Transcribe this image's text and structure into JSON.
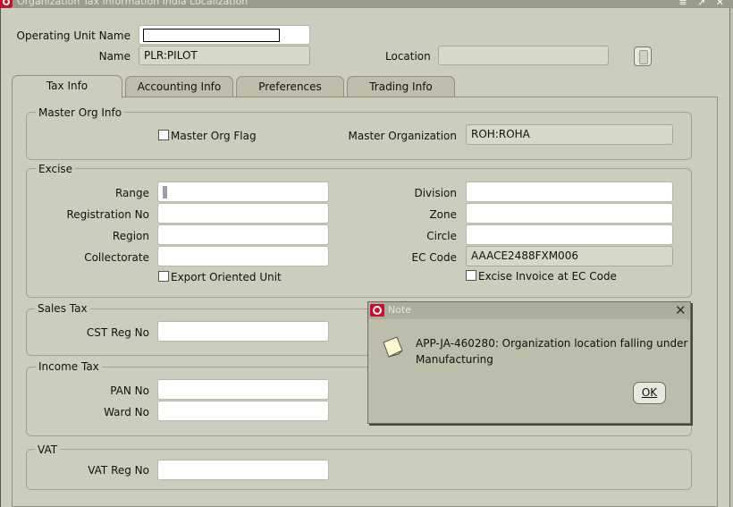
{
  "window": {
    "title": "Organization Tax Information India Localization",
    "controls": "≡ ↗ ✕"
  },
  "header": {
    "operating_unit_label": "Operating Unit Name",
    "operating_unit_value": "",
    "name_label": "Name",
    "name_value": "PLR:PILOT",
    "location_label": "Location",
    "location_value": ""
  },
  "tabs": [
    {
      "label": "Tax Info",
      "active": true
    },
    {
      "label": "Accounting  Info",
      "active": false
    },
    {
      "label": "Preferences",
      "active": false
    },
    {
      "label": "Trading Info",
      "active": false
    }
  ],
  "master_org": {
    "title": "Master Org Info",
    "flag_label": "Master Org Flag",
    "flag_checked": false,
    "org_label": "Master Organization",
    "org_value": "ROH:ROHA"
  },
  "excise": {
    "title": "Excise",
    "range_label": "Range",
    "range_value": "",
    "registration_label": "Registration No",
    "registration_value": "",
    "region_label": "Region",
    "region_value": "",
    "collectorate_label": "Collectorate",
    "collectorate_value": "",
    "export_label": "Export Oriented Unit",
    "export_checked": false,
    "division_label": "Division",
    "division_value": "",
    "zone_label": "Zone",
    "zone_value": "",
    "circle_label": "Circle",
    "circle_value": "",
    "ec_code_label": "EC Code",
    "ec_code_value": "AAACE2488FXM006",
    "invoice_label": "Excise Invoice at EC Code",
    "invoice_checked": false
  },
  "sales_tax": {
    "title": "Sales Tax",
    "cst_label": "CST Reg No",
    "cst_value": ""
  },
  "income_tax": {
    "title": "Income Tax",
    "pan_label": "PAN No",
    "pan_value": "",
    "ward_label": "Ward No",
    "ward_value": ""
  },
  "vat": {
    "title": "VAT",
    "vat_label": "VAT Reg No",
    "vat_value": ""
  },
  "note_dialog": {
    "title": "Note",
    "close_glyph": "✕",
    "message": "APP-JA-460280: Organization location falling under Manufacturing",
    "ok_label": "OK"
  }
}
